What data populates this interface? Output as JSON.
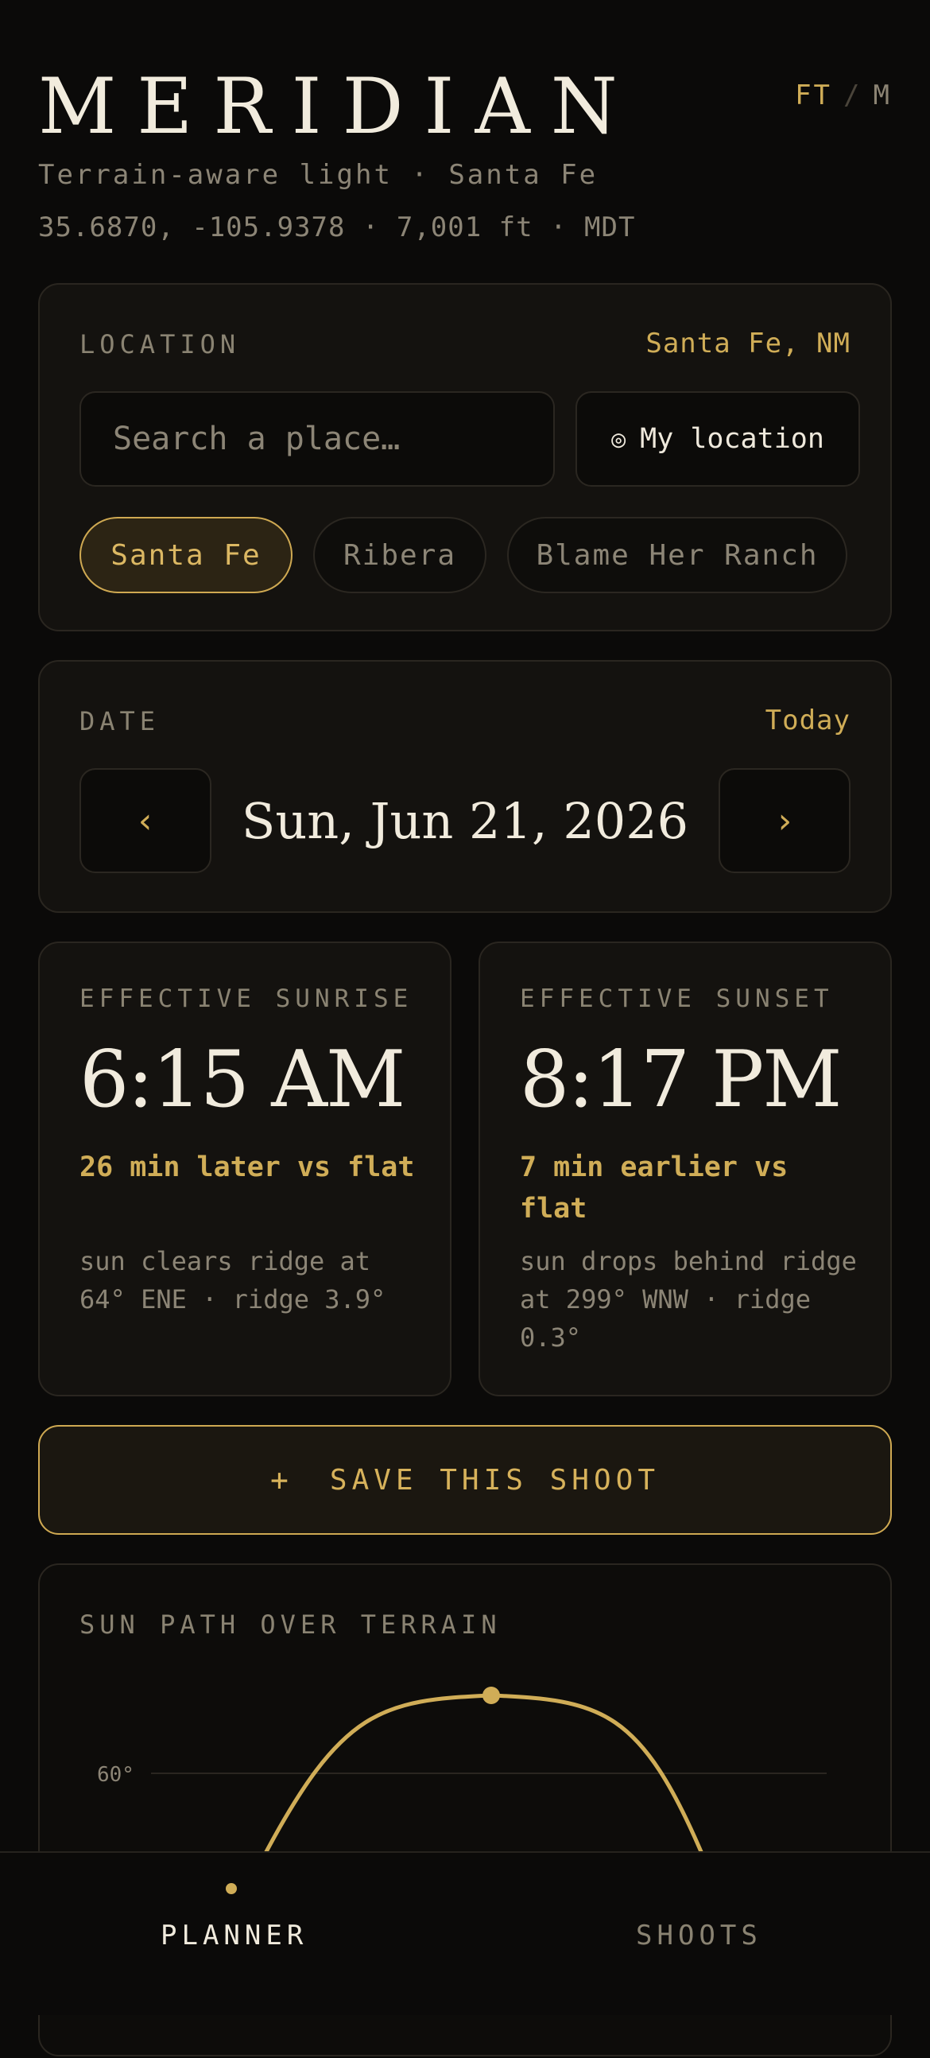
{
  "header": {
    "brand": "MERIDIAN",
    "units": {
      "active": "FT",
      "separator": "/",
      "inactive": "M"
    },
    "subtitle": "Terrain-aware light · Santa Fe",
    "coords": "35.6870, -105.9378 · 7,001 ft · MDT"
  },
  "location": {
    "label": "LOCATION",
    "current": "Santa Fe, NM",
    "search_placeholder": "Search a place…",
    "my_location_icon": "target-icon",
    "my_location_glyph": "◎",
    "my_location_label": "My location",
    "chips": [
      {
        "label": "Santa Fe",
        "active": true
      },
      {
        "label": "Ribera",
        "active": false
      },
      {
        "label": "Blame Her Ranch",
        "active": false
      }
    ]
  },
  "date": {
    "label": "DATE",
    "today": "Today",
    "prev_glyph": "‹",
    "next_glyph": "›",
    "value": "Sun, Jun 21, 2026"
  },
  "sunrise": {
    "label": "EFFECTIVE SUNRISE",
    "time": "6:15 AM",
    "delta": "26 min later vs flat",
    "note": "sun clears ridge at 64° ENE · ridge 3.9°"
  },
  "sunset": {
    "label": "EFFECTIVE SUNSET",
    "time": "8:17 PM",
    "delta": "7 min earlier vs flat",
    "note": "sun drops behind ridge at 299° WNW · ridge 0.3°"
  },
  "save": {
    "icon": "+",
    "label": "SAVE THIS SHOOT"
  },
  "sun_path": {
    "label": "SUN PATH OVER TERRAIN",
    "gridline_label": "60°"
  },
  "tabs": {
    "planner": "PLANNER",
    "shoots": "SHOOTS"
  },
  "colors": {
    "accent": "#d0ad57",
    "background": "#0b0a09",
    "card": "#14120f",
    "muted": "#8c8576"
  }
}
